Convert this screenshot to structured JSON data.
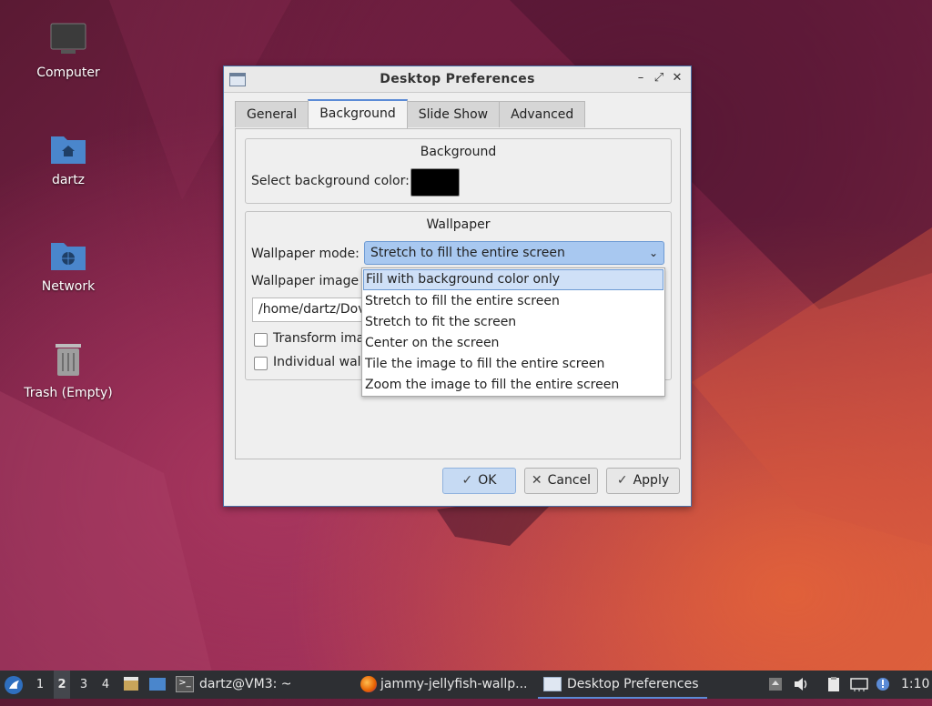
{
  "desktop": {
    "icons": [
      {
        "label": "Computer",
        "icon": "computer-icon"
      },
      {
        "label": "dartz",
        "icon": "home-folder-icon"
      },
      {
        "label": "Network",
        "icon": "network-folder-icon"
      },
      {
        "label": "Trash (Empty)",
        "icon": "trash-icon"
      }
    ]
  },
  "window": {
    "title": "Desktop Preferences",
    "tabs": [
      "General",
      "Background",
      "Slide Show",
      "Advanced"
    ],
    "active_tab": "Background",
    "background_section": {
      "title": "Background",
      "color_label": "Select background color:",
      "color_value": "#000000"
    },
    "wallpaper_section": {
      "title": "Wallpaper",
      "mode_label": "Wallpaper mode:",
      "mode_value": "Stretch to fill the entire screen",
      "image_label": "Wallpaper image f",
      "image_path": "/home/dartz/Dov",
      "transform_label": "Transform ima",
      "individual_label": "Individual wall"
    },
    "dropdown_options": [
      "Fill with background color only",
      "Stretch to fill the entire screen",
      "Stretch to fit the screen",
      "Center on the screen",
      "Tile the image to fill the entire screen",
      "Zoom the image to fill the entire screen"
    ],
    "highlighted_option": "Fill with background color only",
    "buttons": {
      "ok": "OK",
      "cancel": "Cancel",
      "apply": "Apply"
    }
  },
  "taskbar": {
    "workspaces": [
      "1",
      "2",
      "3",
      "4"
    ],
    "current_workspace": "2",
    "tasks": [
      {
        "label": "dartz@VM3: ~",
        "icon": "terminal-icon"
      },
      {
        "label": "jammy-jellyfish-wallp...",
        "icon": "firefox-icon"
      },
      {
        "label": "Desktop Preferences",
        "icon": "window-icon"
      }
    ],
    "clock": "1:10"
  },
  "colors": {
    "accent": "#5b8bd6",
    "selection": "#a8c8f0",
    "taskbar": "#2d2f33"
  }
}
